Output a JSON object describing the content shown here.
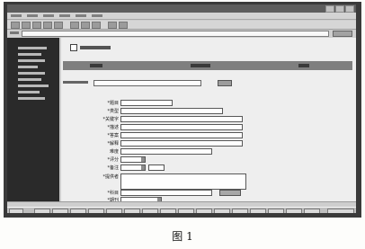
{
  "caption": "图 1",
  "screen": {
    "form_labels": [
      "*题目",
      "*类型",
      "*关键字",
      "*描述",
      "*答案",
      "*解释",
      "难度",
      "*评分",
      "*备注",
      "*提供者",
      "*科目",
      "*期刊"
    ],
    "add_button_icon": "plus-icon"
  }
}
